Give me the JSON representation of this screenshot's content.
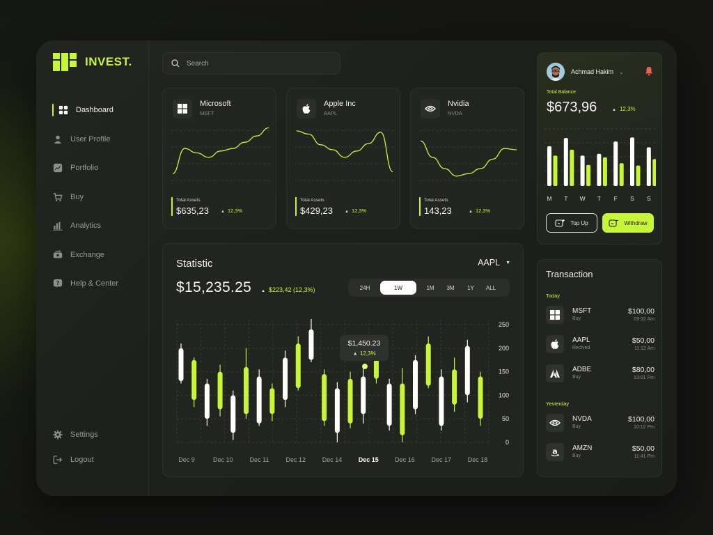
{
  "brand": {
    "name": "INVEST."
  },
  "nav": [
    {
      "label": "Dashboard",
      "icon": "dashboard-icon",
      "active": true
    },
    {
      "label": "User Profile",
      "icon": "user-icon"
    },
    {
      "label": "Portfolio",
      "icon": "portfolio-icon"
    },
    {
      "label": "Buy",
      "icon": "cart-icon"
    },
    {
      "label": "Analytics",
      "icon": "analytics-icon"
    },
    {
      "label": "Exchange",
      "icon": "exchange-icon"
    },
    {
      "label": "Help & Center",
      "icon": "help-icon"
    }
  ],
  "nav_bottom": [
    {
      "label": "Settings",
      "icon": "gear-icon"
    },
    {
      "label": "Logout",
      "icon": "logout-icon"
    }
  ],
  "search": {
    "placeholder": "Search"
  },
  "stocks": [
    {
      "name": "Microsoft",
      "ticker": "MSFT",
      "logo": "microsoft-logo-icon",
      "label": "Total Assets",
      "value": "$635,23",
      "change": "12,3%",
      "trend": [
        0.22,
        0.62,
        0.55,
        0.48,
        0.58,
        0.62,
        0.72,
        0.82,
        0.95
      ]
    },
    {
      "name": "Apple Inc",
      "ticker": "AAPL",
      "logo": "apple-logo-icon",
      "label": "Total Assets",
      "value": "$429,23",
      "change": "12,3%",
      "trend": [
        0.9,
        0.85,
        0.68,
        0.6,
        0.48,
        0.58,
        0.7,
        0.88,
        0.25
      ]
    },
    {
      "name": "Nvidia",
      "ticker": "NVDA",
      "logo": "nvidia-logo-icon",
      "label": "Total Assets",
      "value": "143,23",
      "change": "12,3%",
      "trend": [
        0.74,
        0.48,
        0.3,
        0.18,
        0.22,
        0.3,
        0.45,
        0.62,
        0.6
      ]
    }
  ],
  "statistic": {
    "title": "Statistic",
    "ticker": "AAPL",
    "value": "$15,235.25",
    "change": "$223,42 (12,3%)",
    "ranges": [
      {
        "label": "24H"
      },
      {
        "label": "1W",
        "active": true
      },
      {
        "label": "1M"
      },
      {
        "label": "3M"
      },
      {
        "label": "1Y"
      },
      {
        "label": "ALL"
      }
    ],
    "tooltip": {
      "value": "$1,450.23",
      "change": "12,3%"
    }
  },
  "chart_data": {
    "type": "candlestick",
    "x_labels": [
      "Dec 9",
      "Dec 10",
      "Dec 11",
      "Dec 12",
      "Dec 14",
      "Dec 15",
      "Dec 16",
      "Dec 17",
      "Dec 18"
    ],
    "active_x_label": "Dec 15",
    "y_ticks": [
      0,
      50,
      100,
      150,
      200,
      250
    ],
    "ylim": [
      0,
      250
    ],
    "series": [
      {
        "color": "white",
        "low": 125,
        "open": 130,
        "close": 200,
        "high": 210
      },
      {
        "color": "lime",
        "low": 75,
        "open": 90,
        "close": 175,
        "high": 180
      },
      {
        "color": "white",
        "low": 35,
        "open": 50,
        "close": 125,
        "high": 135
      },
      {
        "color": "lime",
        "low": 55,
        "open": 70,
        "close": 150,
        "high": 165
      },
      {
        "color": "white",
        "low": 5,
        "open": 20,
        "close": 100,
        "high": 110
      },
      {
        "color": "lime",
        "low": 50,
        "open": 60,
        "close": 160,
        "high": 200
      },
      {
        "color": "white",
        "low": 35,
        "open": 40,
        "close": 140,
        "high": 155
      },
      {
        "color": "lime",
        "low": 45,
        "open": 60,
        "close": 115,
        "high": 125
      },
      {
        "color": "white",
        "low": 75,
        "open": 90,
        "close": 180,
        "high": 195
      },
      {
        "color": "lime",
        "low": 110,
        "open": 115,
        "close": 210,
        "high": 225
      },
      {
        "color": "white",
        "low": 170,
        "open": 175,
        "close": 240,
        "high": 262
      },
      {
        "color": "lime",
        "low": 35,
        "open": 45,
        "close": 145,
        "high": 155
      },
      {
        "color": "white",
        "low": 0,
        "open": 20,
        "close": 115,
        "high": 128
      },
      {
        "color": "lime",
        "low": 30,
        "open": 40,
        "close": 135,
        "high": 150
      },
      {
        "color": "white",
        "low": 40,
        "open": 60,
        "close": 140,
        "high": 163
      },
      {
        "color": "lime",
        "low": 125,
        "open": 135,
        "close": 190,
        "high": 205
      },
      {
        "color": "white",
        "low": 25,
        "open": 35,
        "close": 125,
        "high": 135
      },
      {
        "color": "lime",
        "low": 0,
        "open": 15,
        "close": 125,
        "high": 158
      },
      {
        "color": "white",
        "low": 60,
        "open": 70,
        "close": 175,
        "high": 185
      },
      {
        "color": "lime",
        "low": 115,
        "open": 120,
        "close": 210,
        "high": 225
      },
      {
        "color": "white",
        "low": 25,
        "open": 35,
        "close": 140,
        "high": 155
      },
      {
        "color": "lime",
        "low": 65,
        "open": 80,
        "close": 155,
        "high": 180
      },
      {
        "color": "white",
        "low": 85,
        "open": 100,
        "close": 205,
        "high": 218
      },
      {
        "color": "lime",
        "low": 35,
        "open": 50,
        "close": 140,
        "high": 150
      }
    ]
  },
  "balance": {
    "user": "Achmad Hakim",
    "label": "Total Balance",
    "value": "$673,96",
    "change": "12,3%",
    "days": [
      "M",
      "T",
      "W",
      "T",
      "F",
      "S",
      "S"
    ],
    "bars_white": [
      0.68,
      0.82,
      0.52,
      0.55,
      0.76,
      0.83,
      0.66
    ],
    "bars_lime": [
      0.52,
      0.62,
      0.36,
      0.49,
      0.39,
      0.35,
      0.46
    ],
    "topup_label": "Top Up",
    "withdraw_label": "Withdraw"
  },
  "transactions": {
    "title": "Transaction",
    "groups": [
      {
        "label": "Today",
        "items": [
          {
            "symbol": "MSFT",
            "type": "Buy",
            "amount": "$100,00",
            "time": "09:32 Am",
            "logo": "microsoft-logo-icon"
          },
          {
            "symbol": "AAPL",
            "type": "Recived",
            "amount": "$50,00",
            "time": "11:12 Am",
            "logo": "apple-logo-icon"
          },
          {
            "symbol": "ADBE",
            "type": "Buy",
            "amount": "$80,00",
            "time": "13:01 Pm",
            "logo": "adobe-logo-icon"
          }
        ]
      },
      {
        "label": "Yesterday",
        "items": [
          {
            "symbol": "NVDA",
            "type": "Buy",
            "amount": "$100,00",
            "time": "10:12 Pm",
            "logo": "nvidia-logo-icon"
          },
          {
            "symbol": "AMZN",
            "type": "Buy",
            "amount": "$50,00",
            "time": "11:41 Pm",
            "logo": "amazon-logo-icon"
          }
        ]
      }
    ]
  },
  "colors": {
    "accent": "#c6f53a",
    "candle_white": "#ffffff",
    "background": "#161714"
  }
}
